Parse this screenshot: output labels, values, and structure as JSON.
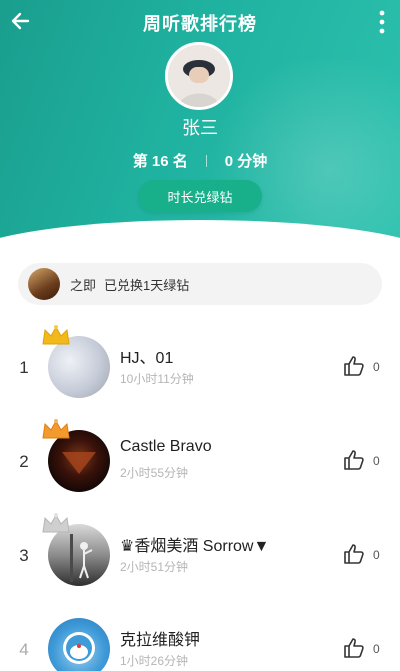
{
  "header": {
    "title": "周听歌排行榜",
    "back_icon": "back-arrow-icon",
    "more_icon": "more-vertical-icon",
    "gradient_colors": [
      "#1a9e8e",
      "#2cc1ae"
    ]
  },
  "profile": {
    "username": "张三",
    "rank_text": "第 16 名",
    "duration_text": "0 分钟",
    "redeem_label": "时长兑绿钻",
    "redeem_color": "#18b08a"
  },
  "notice": {
    "user": "之即",
    "message": "已兑换1天绿钻"
  },
  "ranking": [
    {
      "rank": "1",
      "name": "HJ、01",
      "duration": "10小时11分钟",
      "likes": "0",
      "crown": "gold"
    },
    {
      "rank": "2",
      "name": "Castle Bravo",
      "duration": "2小时55分钟",
      "likes": "0",
      "crown": "orange"
    },
    {
      "rank": "3",
      "name": "♛香烟美酒    Sorrow▼",
      "duration": "2小时51分钟",
      "likes": "0",
      "crown": "silver"
    },
    {
      "rank": "4",
      "name": "克拉维酸钾",
      "duration": "1小时26分钟",
      "likes": "0",
      "crown": ""
    }
  ]
}
